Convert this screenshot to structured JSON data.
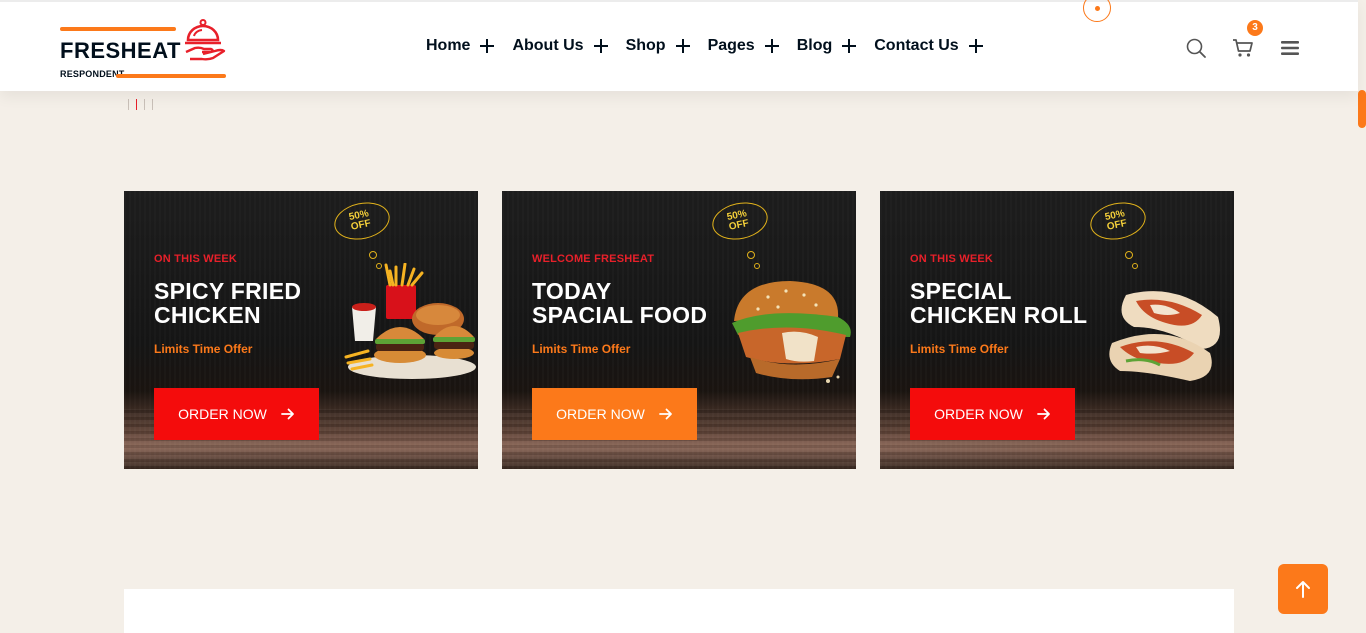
{
  "brand": {
    "name": "FRESHEAT",
    "tagline": "RESPONDENT",
    "accent_color": "#fc791a",
    "red_color": "#f40c0c"
  },
  "nav": {
    "items": [
      {
        "label": "Home"
      },
      {
        "label": "About Us"
      },
      {
        "label": "Shop"
      },
      {
        "label": "Pages"
      },
      {
        "label": "Blog"
      },
      {
        "label": "Contact Us"
      }
    ]
  },
  "header_icons": {
    "search": "search-icon",
    "cart": "cart-icon",
    "cart_count": "3",
    "menu": "hamburger-menu-icon"
  },
  "cards": [
    {
      "tag": "ON THIS WEEK",
      "title_line1": "SPICY FRIED",
      "title_line2": "CHICKEN",
      "offer": "Limits Time Offer",
      "button": "ORDER NOW",
      "discount_line1": "50%",
      "discount_line2": "OFF"
    },
    {
      "tag": "WELCOME FRESHEAT",
      "title_line1": "TODAY",
      "title_line2": "SPACIAL FOOD",
      "offer": "Limits Time Offer",
      "button": "ORDER NOW",
      "discount_line1": "50%",
      "discount_line2": "OFF"
    },
    {
      "tag": "ON THIS WEEK",
      "title_line1": "SPECIAL",
      "title_line2": "CHICKEN ROLL",
      "offer": "Limits Time Offer",
      "button": "ORDER NOW",
      "discount_line1": "50%",
      "discount_line2": "OFF"
    }
  ],
  "scroll_to_top": "arrow-up-icon"
}
